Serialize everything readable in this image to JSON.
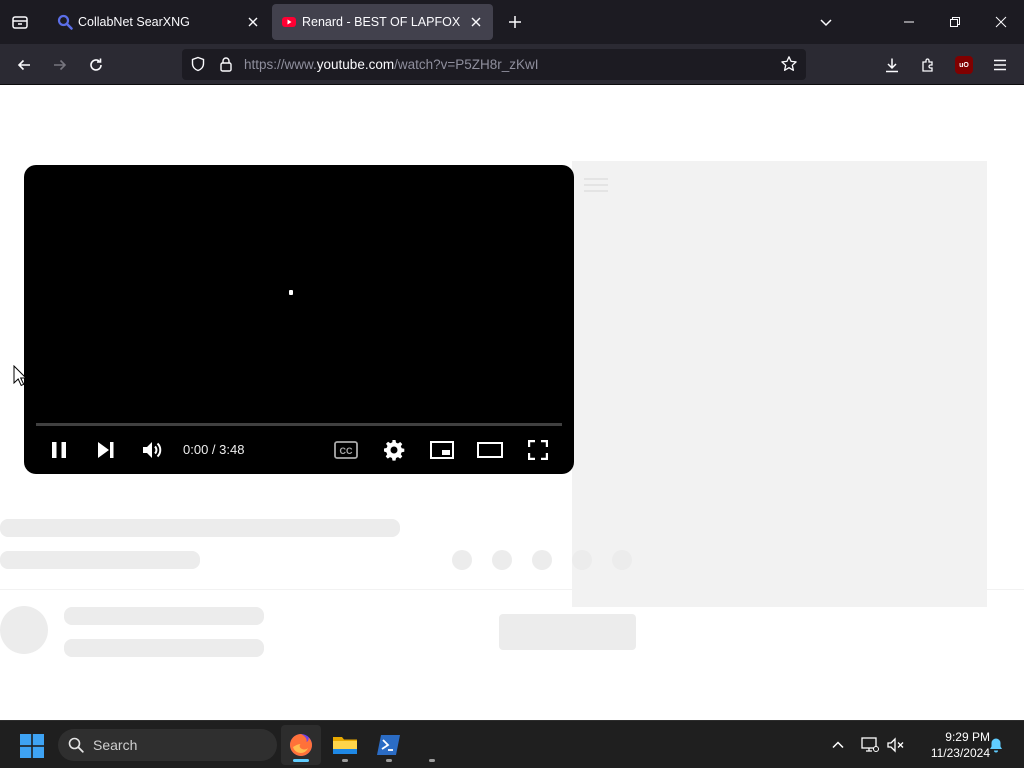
{
  "browser": {
    "tabs": [
      {
        "title": "CollabNet SearXNG",
        "active": false,
        "favicon": "search-magnifier-icon"
      },
      {
        "title": "Renard - BEST OF LAPFOX VOL",
        "active": true,
        "favicon": "youtube-icon"
      }
    ],
    "url": {
      "prefix": "https://www.",
      "host": "youtube.com",
      "path": "/watch?v=P5ZH8r_zKwI"
    },
    "extensions": {
      "ublock_label": "uO"
    },
    "colors": {
      "tab_strip": "#1c1b22",
      "toolbar": "#2b2a33",
      "active_tab": "#42414d"
    }
  },
  "player": {
    "current_time": "0:00",
    "duration": "3:48",
    "time_display": "0:00 / 3:48",
    "progress": 0,
    "state": "playing",
    "controls": [
      "pause",
      "next",
      "volume",
      "captions",
      "settings",
      "miniplayer",
      "theater",
      "fullscreen"
    ]
  },
  "taskbar": {
    "search_label": "Search",
    "apps": [
      "firefox",
      "file-explorer",
      "powershell"
    ],
    "clock": {
      "time": "9:29 PM",
      "date": "11/23/2024"
    }
  }
}
